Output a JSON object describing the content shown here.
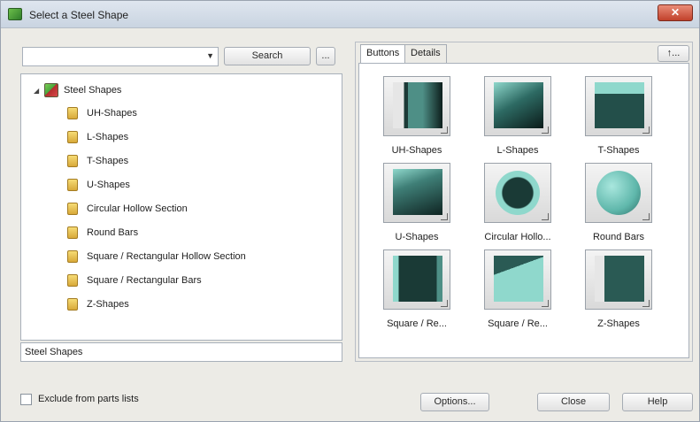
{
  "window": {
    "title": "Select a Steel Shape",
    "close_glyph": "✕"
  },
  "search": {
    "value": "",
    "button_label": "Search",
    "browse_label": "..."
  },
  "tree": {
    "root_label": "Steel Shapes",
    "items": [
      {
        "label": "UH-Shapes"
      },
      {
        "label": "L-Shapes"
      },
      {
        "label": "T-Shapes"
      },
      {
        "label": "U-Shapes"
      },
      {
        "label": "Circular Hollow Section"
      },
      {
        "label": "Round Bars"
      },
      {
        "label": "Square / Rectangular Hollow Section"
      },
      {
        "label": "Square / Rectangular Bars"
      },
      {
        "label": "Z-Shapes"
      }
    ]
  },
  "status": {
    "text": "Steel Shapes"
  },
  "tabs": {
    "buttons": "Buttons",
    "details": "Details",
    "up_label": "↑..."
  },
  "shapes": [
    {
      "label": "UH-Shapes"
    },
    {
      "label": "L-Shapes"
    },
    {
      "label": "T-Shapes"
    },
    {
      "label": "U-Shapes"
    },
    {
      "label": "Circular Hollo..."
    },
    {
      "label": "Round Bars"
    },
    {
      "label": "Square / Re..."
    },
    {
      "label": "Square / Re..."
    },
    {
      "label": "Z-Shapes"
    }
  ],
  "footer": {
    "exclude_label": "Exclude from parts lists",
    "options_label": "Options...",
    "close_label": "Close",
    "help_label": "Help"
  }
}
